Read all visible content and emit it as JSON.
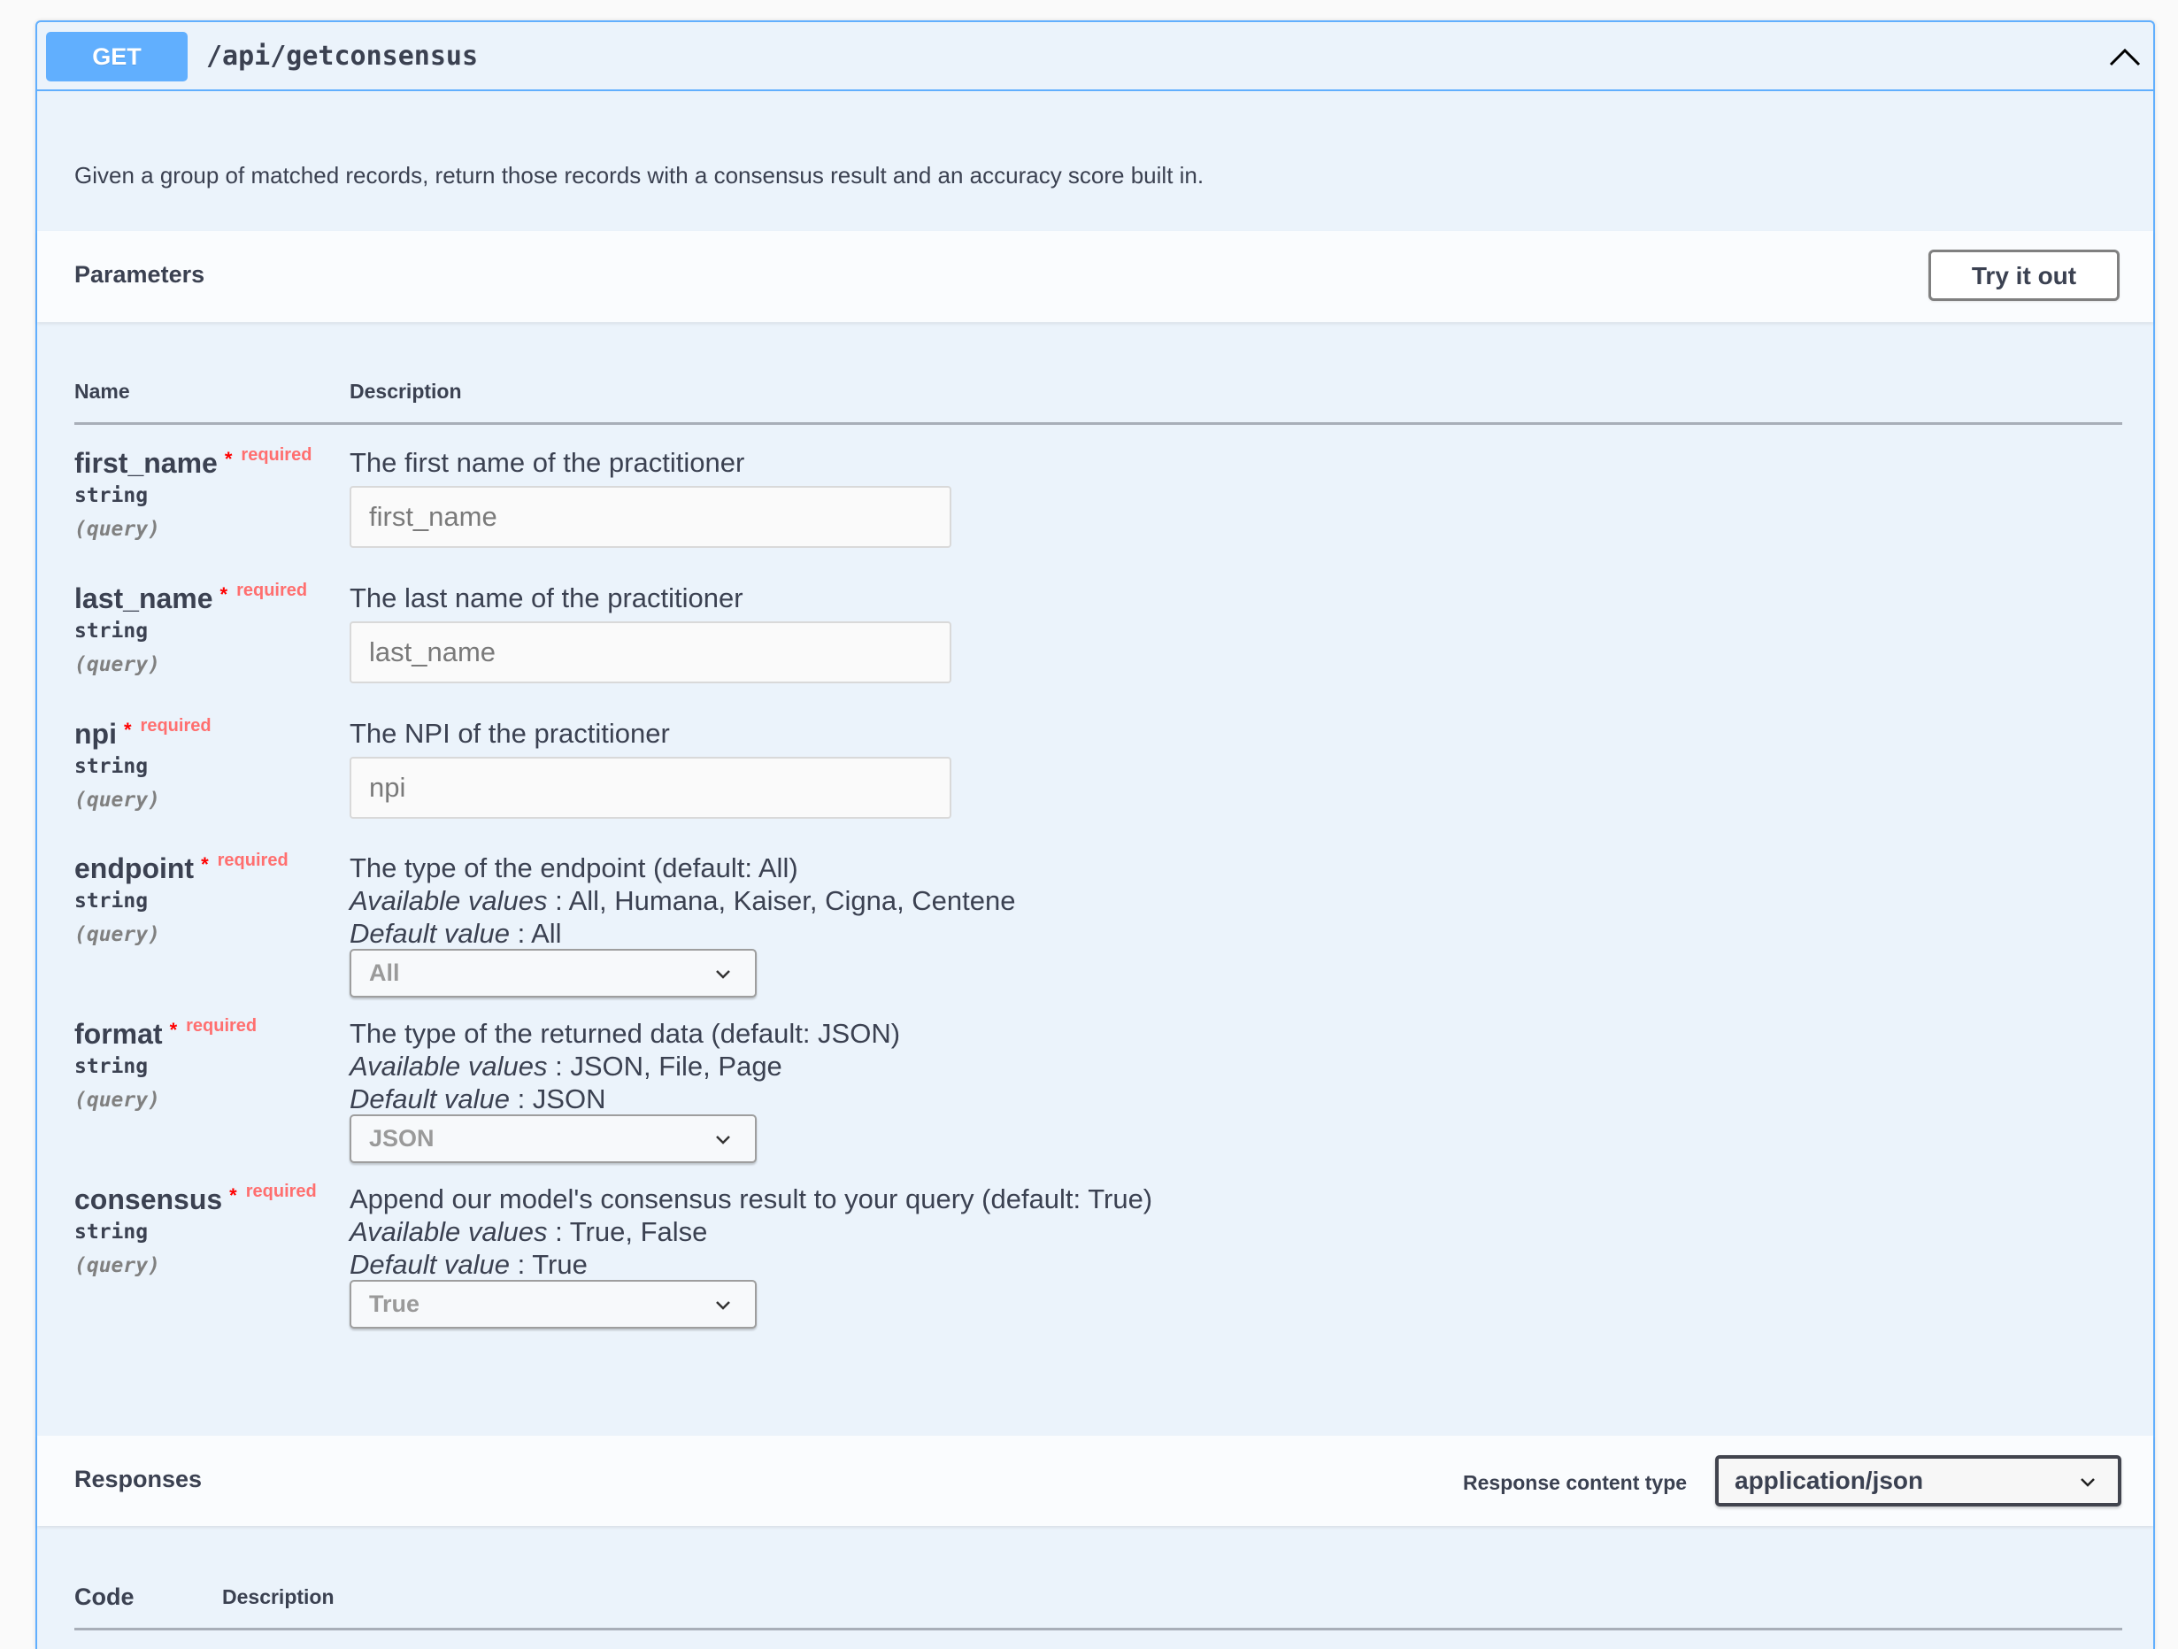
{
  "operation": {
    "method": "GET",
    "path": "/api/getconsensus",
    "summary": "Given a group of matched records, return those records with a consensus result and an accuracy score built in.",
    "collapse_icon": "chevron-up-icon",
    "method_color": "#61affe"
  },
  "parameters": {
    "title": "Parameters",
    "try_it_out_label": "Try it out",
    "columns": {
      "name": "Name",
      "description": "Description"
    },
    "required_star": "*",
    "required_label": "required",
    "items": [
      {
        "name": "first_name",
        "type": "string",
        "in": "(query)",
        "description": "The first name of the practitioner",
        "placeholder": "first_name"
      },
      {
        "name": "last_name",
        "type": "string",
        "in": "(query)",
        "description": "The last name of the practitioner",
        "placeholder": "last_name"
      },
      {
        "name": "npi",
        "type": "string",
        "in": "(query)",
        "description": "The NPI of the practitioner",
        "placeholder": "npi"
      },
      {
        "name": "endpoint",
        "type": "string",
        "in": "(query)",
        "description": "The type of the endpoint (default: All)",
        "available_label": "Available values",
        "available_values": ": All, Humana, Kaiser, Cigna, Centene",
        "default_label": "Default value",
        "default_value": ": All",
        "selected": "All"
      },
      {
        "name": "format",
        "type": "string",
        "in": "(query)",
        "description": "The type of the returned data (default: JSON)",
        "available_label": "Available values",
        "available_values": ": JSON, File, Page",
        "default_label": "Default value",
        "default_value": ": JSON",
        "selected": "JSON"
      },
      {
        "name": "consensus",
        "type": "string",
        "in": "(query)",
        "description": "Append our model's consensus result to your query (default: True)",
        "available_label": "Available values",
        "available_values": ": True, False",
        "default_label": "Default value",
        "default_value": ": True",
        "selected": "True"
      }
    ]
  },
  "responses": {
    "title": "Responses",
    "content_type_label": "Response content type",
    "content_type_selected": "application/json",
    "columns": {
      "code": "Code",
      "description": "Description"
    }
  }
}
